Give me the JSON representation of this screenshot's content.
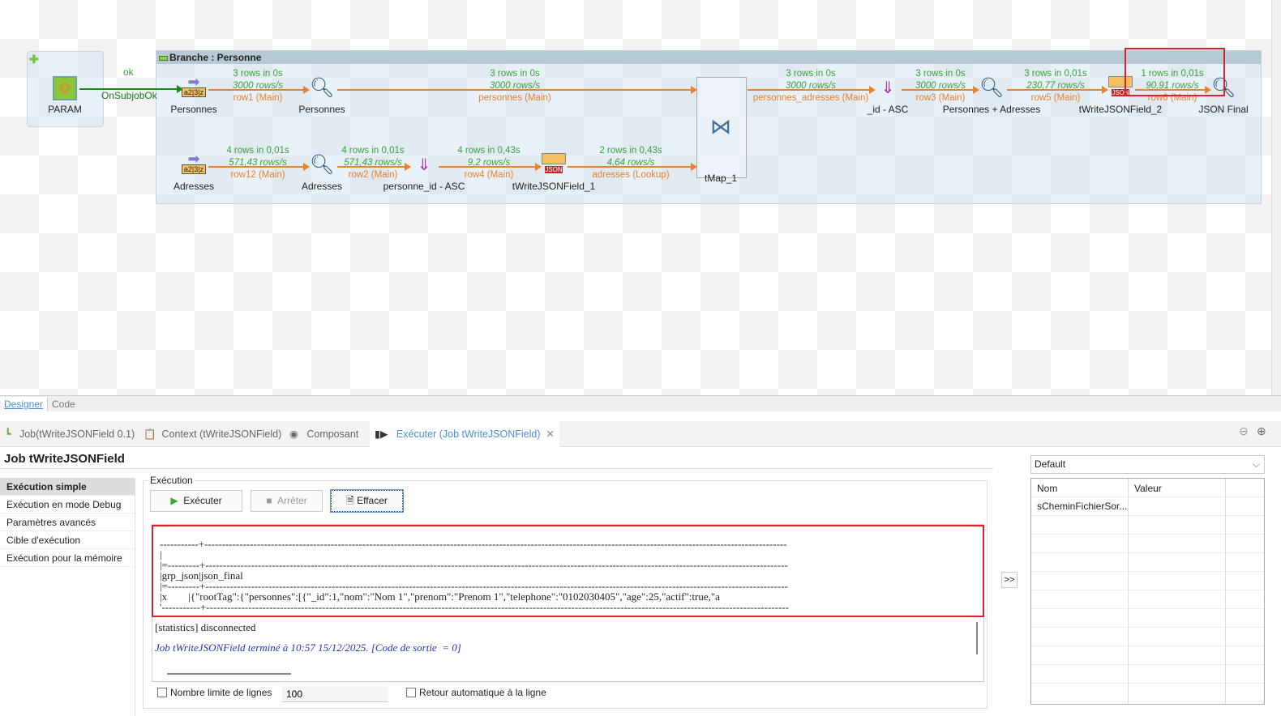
{
  "canvas": {
    "subjob_title": "Branche : Personne",
    "trigger": {
      "top": "ok",
      "bottom": "OnSubjobOk"
    },
    "components": [
      {
        "label": "PARAM",
        "icon": "param-icon"
      },
      {
        "label": "Personnes",
        "icon": "file-input-icon"
      },
      {
        "label": "Personnes",
        "icon": "log-row-icon"
      },
      {
        "label": "tMap_1",
        "icon": "tmap-icon"
      },
      {
        "label": "_id - ASC",
        "icon": "sort-icon"
      },
      {
        "label": "Personnes + Adresses",
        "icon": "log-row-icon"
      },
      {
        "label": "tWriteJSONField_2",
        "icon": "json-icon"
      },
      {
        "label": "JSON Final",
        "icon": "log-row-icon"
      },
      {
        "label": "Adresses",
        "icon": "file-input-icon"
      },
      {
        "label": "Adresses",
        "icon": "log-row-icon"
      },
      {
        "label": "personne_id - ASC",
        "icon": "sort-icon"
      },
      {
        "label": "tWriteJSONField_1",
        "icon": "json-icon"
      }
    ],
    "links": [
      {
        "rows": "3 rows in 0s",
        "rate": "3000 rows/s",
        "name": "row1 (Main)"
      },
      {
        "rows": "3 rows in 0s",
        "rate": "3000 rows/s",
        "name": "personnes (Main)"
      },
      {
        "rows": "3 rows in 0s",
        "rate": "3000 rows/s",
        "name": "personnes_adresses (Main)"
      },
      {
        "rows": "3 rows in 0s",
        "rate": "3000 rows/s",
        "name": "row3 (Main)"
      },
      {
        "rows": "3 rows in 0,01s",
        "rate": "230,77 rows/s",
        "name": "row5 (Main)"
      },
      {
        "rows": "1 rows in 0,01s",
        "rate": "90,91 rows/s",
        "name": "row6 (Main)"
      },
      {
        "rows": "4 rows in 0,01s",
        "rate": "571,43 rows/s",
        "name": "row12 (Main)"
      },
      {
        "rows": "4 rows in 0,01s",
        "rate": "571,43 rows/s",
        "name": "row2 (Main)"
      },
      {
        "rows": "4 rows in 0,43s",
        "rate": "9,2 rows/s",
        "name": "row4 (Main)"
      },
      {
        "rows": "2 rows in 0,43s",
        "rate": "4,64 rows/s",
        "name": "adresses (Lookup)"
      }
    ]
  },
  "editor_tabs": [
    "Designer",
    "Code"
  ],
  "view_tabs": [
    "Job(tWriteJSONField 0.1)",
    "Context (tWriteJSONField)",
    "Composant",
    "Exécuter (Job tWriteJSONField)"
  ],
  "run": {
    "title": "Job tWriteJSONField",
    "nav": [
      "Exécution simple",
      "Exécution en mode Debug",
      "Paramètres avancés",
      "Cible d'exécution",
      "Exécution pour la mémoire"
    ],
    "group_label": "Exécution",
    "buttons": {
      "run": "Exécuter",
      "stop": "Arrêter",
      "clear": "Effacer"
    },
    "console": [
      "-----------+----------------------------------------------------------------------------------------------------------------------------------------------------------------------",
      "|",
      "|=---------+----------------------------------------------------------------------------------------------------------------------------------------------------------------------",
      "|grp_json|json_final",
      "|=---------+----------------------------------------------------------------------------------------------------------------------------------------------------------------------",
      "|x        |{\"rootTag\":{\"personnes\":[{\"_id\":1,\"nom\":\"Nom 1\",\"prenom\":\"Prenom 1\",\"telephone\":\"0102030405\",\"age\":25,\"actif\":true,\"a",
      "'-----------+----------------------------------------------------------------------------------------------------------------------------------------------------------------------",
      "[statistics] disconnected",
      "Job tWriteJSONField terminé à 10:57 15/12/2025. [Code de sortie  = 0]"
    ],
    "limit_label": "Nombre limite de lignes",
    "limit_value": "100",
    "wrap_label": "Retour automatique à la ligne"
  },
  "context": {
    "selected": "Default",
    "columns": [
      "Nom",
      "Valeur"
    ],
    "rows": [
      {
        "name": "sCheminFichierSor...",
        "value": ""
      }
    ],
    "move_button": ">>"
  },
  "colors": {
    "accent": "#4a90d9",
    "link": "#e8822d",
    "stats": "#3ba03b",
    "highlight": "#e0202a"
  }
}
